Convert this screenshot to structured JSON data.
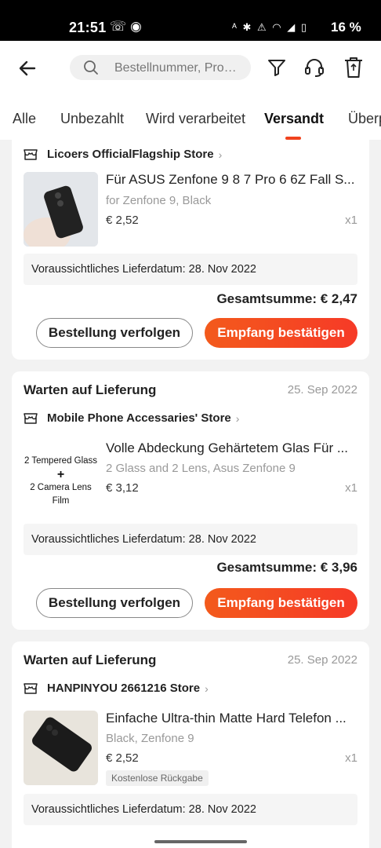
{
  "status_bar": {
    "time": "21:51",
    "left_icons": "☏ ◉",
    "right_icons": "ᴬ ✱ ⚠ ◠ ◢ ▯",
    "battery": "16 %"
  },
  "header": {
    "back_icon": "arrow-left-icon",
    "search_placeholder": "Bestellnummer, Pro…",
    "icons": [
      "search-icon",
      "filter-icon",
      "headset-icon",
      "trash-icon"
    ]
  },
  "tabs": [
    {
      "label": "Alle"
    },
    {
      "label": "Unbezahlt"
    },
    {
      "label": "Wird verarbeitet"
    },
    {
      "label": "Versandt",
      "active": true
    },
    {
      "label": "Überp"
    }
  ],
  "accent_color": "#f0431e",
  "orders": [
    {
      "status": "",
      "date": "",
      "store": "Licoers OfficialFlagship Store",
      "product_title": "Für ASUS Zenfone 9 8 7 Pro 6 6Z Fall S...",
      "variant": "for Zenfone 9, Black",
      "price": "€ 2,52",
      "qty": "x1",
      "delivery": "Voraussichtliches Lieferdatum: 28. Nov 2022",
      "total": "Gesamtsumme: € 2,47",
      "btn_track": "Bestellung verfolgen",
      "btn_confirm": "Empfang bestätigen"
    },
    {
      "status": "Warten auf Lieferung",
      "date": "25. Sep 2022",
      "store": "Mobile Phone Accessaries' Store",
      "product_title": "Volle Abdeckung Gehärtetem Glas Für ...",
      "thumb_text": [
        "2 Tempered Glass",
        "+",
        "2 Camera Lens Film"
      ],
      "variant": "2 Glass and 2 Lens, Asus Zenfone 9",
      "price": "€ 3,12",
      "qty": "x1",
      "delivery": "Voraussichtliches Lieferdatum: 28. Nov 2022",
      "total": "Gesamtsumme: € 3,96",
      "btn_track": "Bestellung verfolgen",
      "btn_confirm": "Empfang bestätigen"
    },
    {
      "status": "Warten auf Lieferung",
      "date": "25. Sep 2022",
      "store": "HANPINYOU 2661216 Store",
      "product_title": "Einfache Ultra-thin Matte Hard Telefon ...",
      "variant": "Black, Zenfone 9",
      "price": "€ 2,52",
      "qty": "x1",
      "badge": "Kostenlose Rückgabe",
      "delivery": "Voraussichtliches Lieferdatum: 28. Nov 2022"
    }
  ]
}
